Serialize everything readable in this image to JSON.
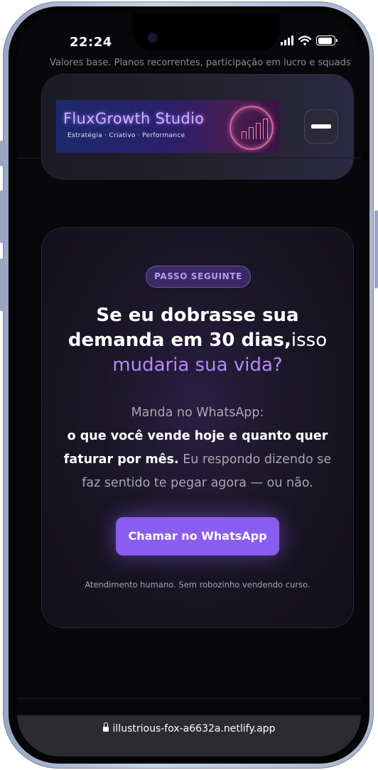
{
  "status_bar": {
    "time": "22:24"
  },
  "page": {
    "cut_text": "Valores base. Planos recorrentes, participação em lucro e squads"
  },
  "logo": {
    "title": "FluxGrowth Studio",
    "tagline": "Estratégia · Criativo · Performance"
  },
  "cta_section": {
    "badge": "PASSO SEGUINTE",
    "headline_line1": "Se eu dobrasse sua",
    "headline_line2_bold": "demanda em 30 dias,",
    "headline_line2_light": "isso",
    "headline_line3_a": "mudaria ",
    "headline_line3_b": "sua vida?",
    "body_line1": "Manda no WhatsApp:",
    "body_bold": "o que você vende hoje e quanto quer faturar por mês.",
    "body_rest": " Eu respondo dizendo se faz sentido te pegar agora — ou não.",
    "button_label": "Chamar no WhatsApp",
    "footnote": "Atendimento humano. Sem robozinho vendendo curso."
  },
  "browser": {
    "url": "illustrious-fox-a6632a.netlify.app"
  },
  "colors": {
    "accent": "#8a5cf0",
    "accent_light": "#b58af7",
    "background": "#07070c"
  }
}
